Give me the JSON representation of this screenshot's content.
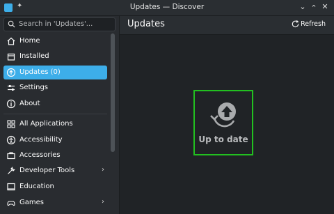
{
  "window": {
    "title": "Updates — Discover"
  },
  "search": {
    "placeholder": "Search in 'Updates'..."
  },
  "sidebar": {
    "items": [
      {
        "label": "Home",
        "icon": "home-icon"
      },
      {
        "label": "Installed",
        "icon": "installed-icon"
      },
      {
        "label": "Updates (0)",
        "icon": "update-icon",
        "active": true
      },
      {
        "label": "Settings",
        "icon": "settings-icon"
      },
      {
        "label": "About",
        "icon": "info-icon"
      }
    ],
    "categories": [
      {
        "label": "All Applications",
        "icon": "grid-icon"
      },
      {
        "label": "Accessibility",
        "icon": "accessibility-icon"
      },
      {
        "label": "Accessories",
        "icon": "briefcase-icon"
      },
      {
        "label": "Developer Tools",
        "icon": "tools-icon",
        "expandable": true
      },
      {
        "label": "Education",
        "icon": "education-icon"
      },
      {
        "label": "Games",
        "icon": "games-icon",
        "expandable": true
      }
    ]
  },
  "header": {
    "title": "Updates",
    "refresh_label": "Refresh"
  },
  "main": {
    "status_text": "Up to date"
  },
  "colors": {
    "accent": "#3daee9",
    "highlight_box": "#22c020",
    "background": "#202326"
  }
}
